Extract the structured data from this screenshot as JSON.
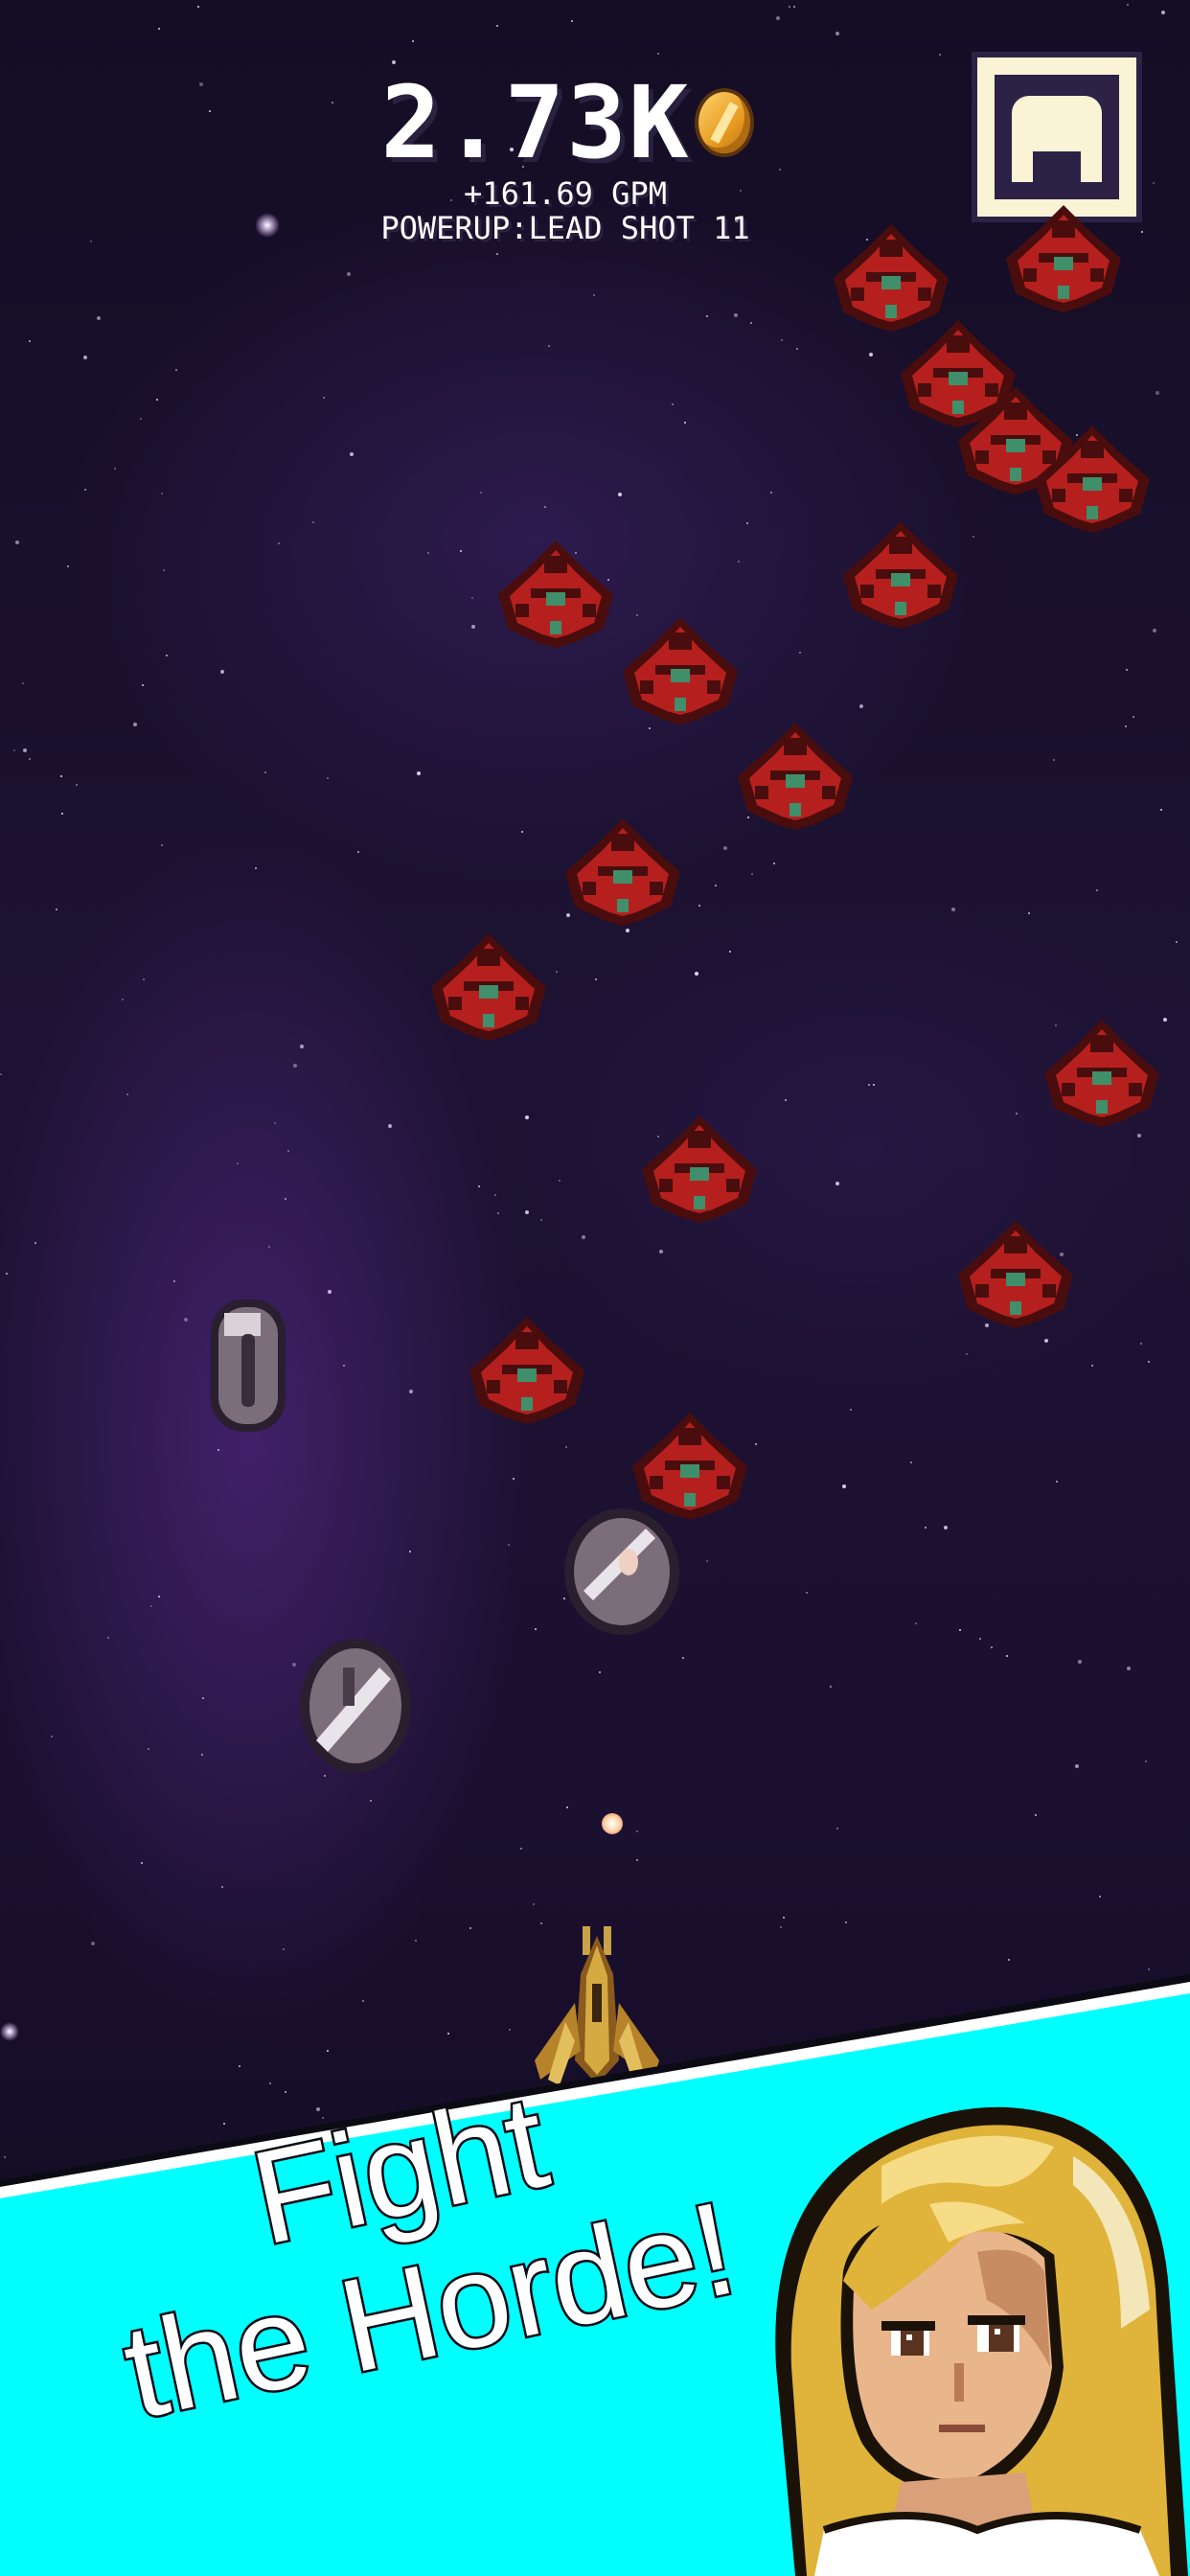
{
  "hud": {
    "gold": "2.73K",
    "gold_icon": "gold-coin-icon",
    "gpm": "+161.69 GPM",
    "powerup": "POWERUP:LEAD SHOT 11"
  },
  "menu_button": {
    "icon": "shop-menu-icon"
  },
  "banner": {
    "line1": "Fight",
    "line2": "the Horde!",
    "background_color": "#00ffff"
  },
  "colors": {
    "enemy_red": "#b5201e",
    "enemy_dark": "#4a0d0d",
    "enemy_green": "#3f8f6a",
    "player_gold": "#c99a2e"
  }
}
